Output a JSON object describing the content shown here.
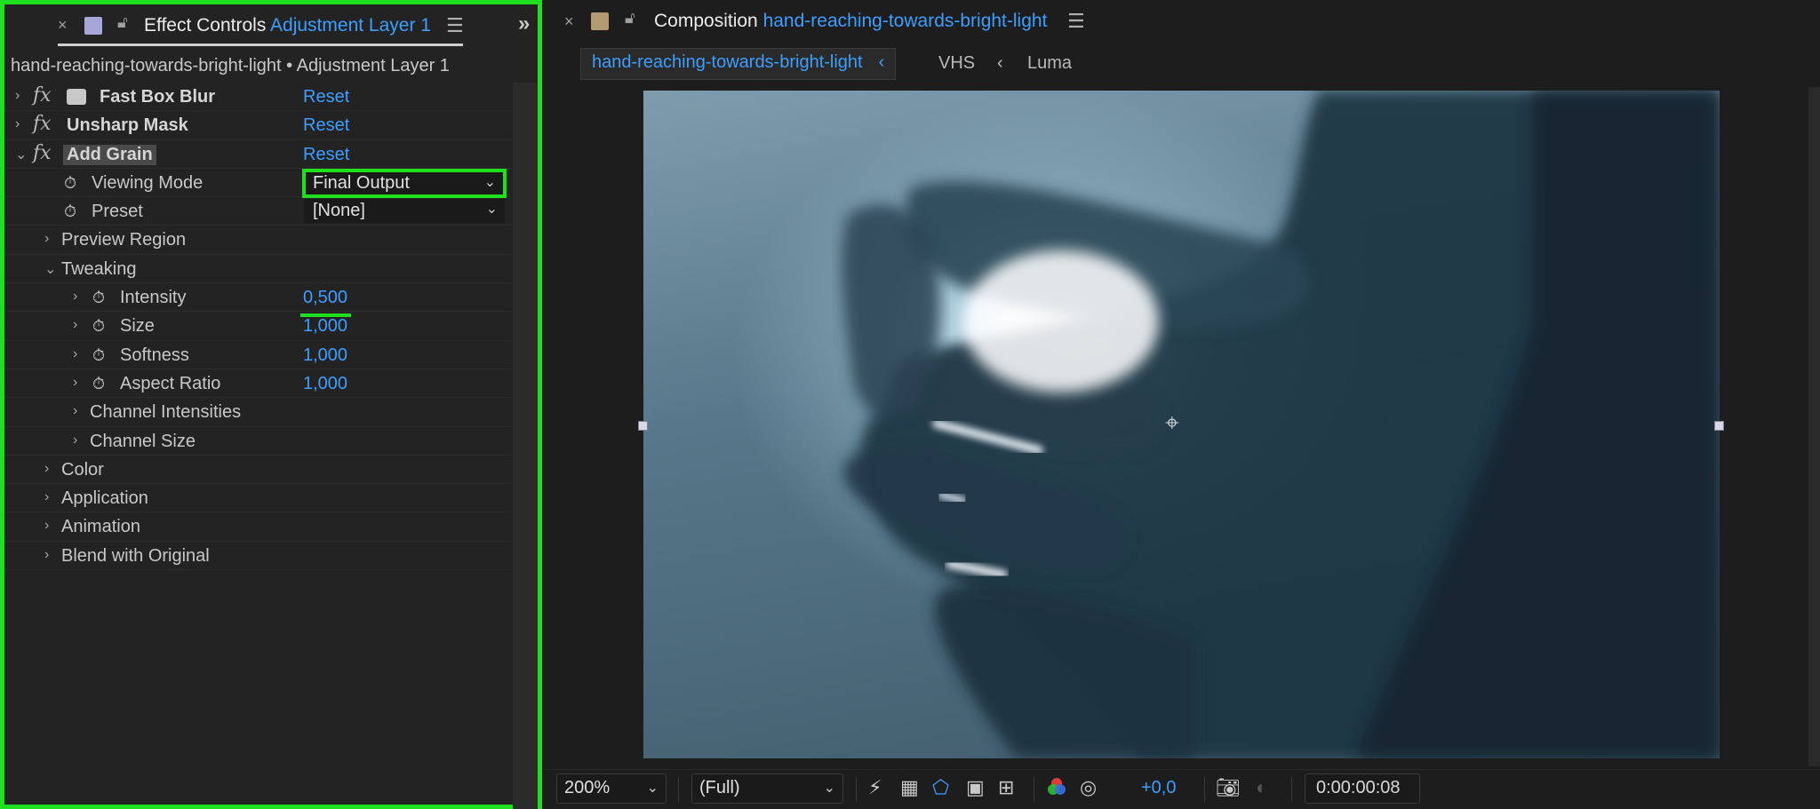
{
  "effect_controls": {
    "close": "×",
    "title_prefix": "Effect Controls",
    "title_layer": "Adjustment Layer 1",
    "menu_icon": "☰",
    "expand_icon": "»",
    "path": "hand-reaching-towards-bright-light • Adjustment Layer 1",
    "swatch_color": "#a6a6d8",
    "effects": [
      {
        "name": "Fast Box Blur",
        "reset": "Reset"
      },
      {
        "name": "Unsharp Mask",
        "reset": "Reset"
      },
      {
        "name": "Add Grain",
        "reset": "Reset"
      }
    ],
    "viewing_mode": {
      "label": "Viewing Mode",
      "value": "Final Output"
    },
    "preset": {
      "label": "Preset",
      "value": "[None]"
    },
    "preview_region": "Preview Region",
    "tweaking": {
      "label": "Tweaking",
      "intensity": {
        "label": "Intensity",
        "value": "0,500"
      },
      "size": {
        "label": "Size",
        "value": "1,000"
      },
      "softness": {
        "label": "Softness",
        "value": "1,000"
      },
      "aspect_ratio": {
        "label": "Aspect Ratio",
        "value": "1,000"
      },
      "channel_intensities": "Channel Intensities",
      "channel_size": "Channel Size"
    },
    "color": "Color",
    "application": "Application",
    "animation": "Animation",
    "blend": "Blend with Original"
  },
  "composition": {
    "close": "×",
    "title_prefix": "Composition",
    "title_name": "hand-reaching-towards-bright-light",
    "menu_icon": "☰",
    "tabs": {
      "active": "hand-reaching-towards-bright-light",
      "tab2": "VHS",
      "tab3": "Luma"
    },
    "toolbar": {
      "zoom": "200%",
      "resolution": "(Full)",
      "exposure": "+0,0",
      "timecode": "0:00:00:08"
    }
  }
}
